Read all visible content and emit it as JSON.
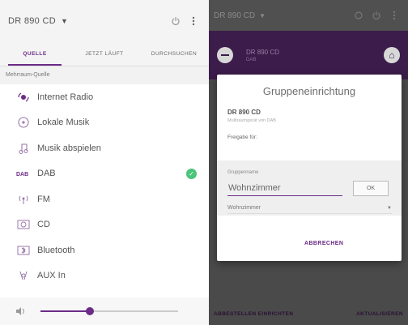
{
  "left": {
    "device": "DR 890 CD",
    "tabs": [
      "QUELLE",
      "JETZT LÄUFT",
      "DURCHSUCHEN"
    ],
    "section_label": "Mehrraum-Quelle",
    "sources": [
      {
        "label": "Internet Radio",
        "icon": "internet-radio-icon",
        "checked": false
      },
      {
        "label": "Lokale Musik",
        "icon": "local-music-icon",
        "checked": false
      },
      {
        "label": "Musik abspielen",
        "icon": "music-note-icon",
        "checked": false
      },
      {
        "label": "DAB",
        "icon": "dab-icon",
        "checked": true
      },
      {
        "label": "FM",
        "icon": "fm-antenna-icon",
        "checked": false
      },
      {
        "label": "CD",
        "icon": "cd-icon",
        "checked": false
      },
      {
        "label": "Bluetooth",
        "icon": "bluetooth-icon",
        "checked": false
      },
      {
        "label": "AUX In",
        "icon": "aux-icon",
        "checked": false
      }
    ],
    "volume_level": 0.36
  },
  "right": {
    "device": "DR 890 CD",
    "group_device": "DR 890 CD",
    "group_device_sub": "DAB",
    "bottom_left": "ABBESTELLEN EINRICHTEN",
    "bottom_right": "AKTUALISIEREN",
    "dialog": {
      "title": "Gruppeneinrichtung",
      "device": "DR 890 CD",
      "device_sub": "Multiraumgerät von DAB",
      "release": "Freigabe für:",
      "group_label": "Gruppenname",
      "input_value": "Wohnzimmer",
      "ok": "OK",
      "select_value": "Wohnzimmer",
      "cancel": "ABBRECHEN"
    }
  },
  "colors": {
    "accent": "#6b2c87",
    "check": "#4cc47c"
  }
}
